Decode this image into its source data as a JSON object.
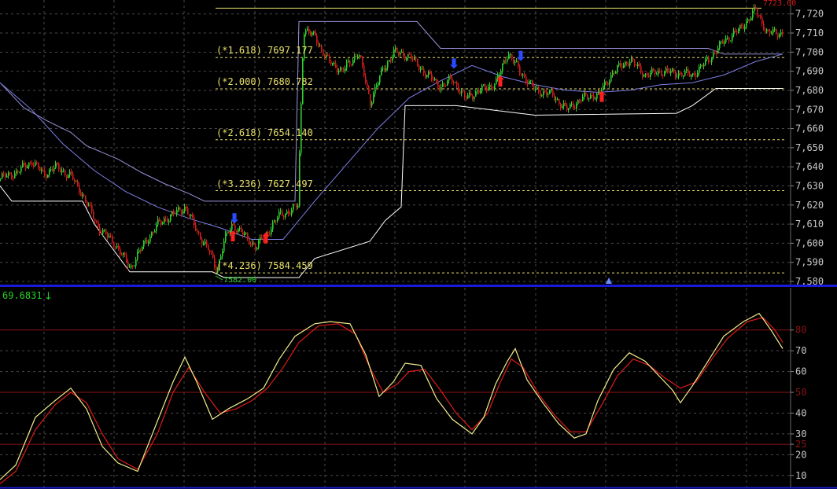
{
  "colors": {
    "background": "#000000",
    "grid": "#4a4a4a",
    "separator": "#1a1ad8",
    "candle_up": "#2fd02f",
    "candle_down": "#d01c1c",
    "fib": "#e8e06a",
    "envelope": "#ffffff",
    "channel": "#9a94d8",
    "moving_average": "#7e7ee6",
    "stoch_k": "#f2ee8c",
    "stoch_d": "#e01b1b",
    "level_line": "#8a1414",
    "signal_sell": "#2a4bff",
    "signal_buy": "#ff2020",
    "axis_text": "#c8c8c8",
    "indicator_value": "#24d024"
  },
  "price_panel": {
    "high_marker": "7723.00",
    "low_marker": "7582.00",
    "fib_levels": [
      {
        "label": "(*1.618) 7697.177",
        "value": 7697.177
      },
      {
        "label": "(*2.000) 7680.782",
        "value": 7680.782
      },
      {
        "label": "(*2.618) 7654.140",
        "value": 7654.14
      },
      {
        "label": "(*3.236) 7627.497",
        "value": 7627.497
      },
      {
        "label": "(*4.236) 7584.459",
        "value": 7584.459
      }
    ]
  },
  "indicator_panel": {
    "value": "69.6831",
    "arrow": "↓"
  },
  "chart_data": [
    {
      "type": "candlestick",
      "ylim": [
        7580,
        7724
      ],
      "y_ticks": [
        "7,580",
        "7,590",
        "7,600",
        "7,610",
        "7,620",
        "7,630",
        "7,640",
        "7,650",
        "7,660",
        "7,670",
        "7,680",
        "7,690",
        "7,700",
        "7,710",
        "7,720"
      ],
      "y_tick_values": [
        7580,
        7590,
        7600,
        7610,
        7620,
        7630,
        7640,
        7650,
        7660,
        7670,
        7680,
        7690,
        7700,
        7710,
        7720
      ],
      "close_path": [
        [
          0,
          7634
        ],
        [
          20,
          7637
        ],
        [
          40,
          7643
        ],
        [
          55,
          7636
        ],
        [
          70,
          7640
        ],
        [
          90,
          7635
        ],
        [
          105,
          7625
        ],
        [
          125,
          7608
        ],
        [
          145,
          7600
        ],
        [
          165,
          7587
        ],
        [
          180,
          7598
        ],
        [
          200,
          7610
        ],
        [
          215,
          7614
        ],
        [
          235,
          7619
        ],
        [
          250,
          7606
        ],
        [
          265,
          7596
        ],
        [
          275,
          7586
        ],
        [
          285,
          7602
        ],
        [
          295,
          7610
        ],
        [
          310,
          7604
        ],
        [
          325,
          7598
        ],
        [
          340,
          7606
        ],
        [
          355,
          7615
        ],
        [
          370,
          7617
        ],
        [
          378,
          7620
        ],
        [
          385,
          7712
        ],
        [
          400,
          7708
        ],
        [
          415,
          7696
        ],
        [
          435,
          7690
        ],
        [
          455,
          7700
        ],
        [
          470,
          7674
        ],
        [
          485,
          7690
        ],
        [
          500,
          7700
        ],
        [
          520,
          7698
        ],
        [
          540,
          7689
        ],
        [
          560,
          7682
        ],
        [
          575,
          7686
        ],
        [
          590,
          7676
        ],
        [
          610,
          7680
        ],
        [
          630,
          7684
        ],
        [
          645,
          7700
        ],
        [
          660,
          7690
        ],
        [
          680,
          7680
        ],
        [
          700,
          7678
        ],
        [
          720,
          7670
        ],
        [
          740,
          7676
        ],
        [
          760,
          7678
        ],
        [
          780,
          7690
        ],
        [
          800,
          7696
        ],
        [
          820,
          7688
        ],
        [
          840,
          7690
        ],
        [
          860,
          7689
        ],
        [
          880,
          7688
        ],
        [
          900,
          7696
        ],
        [
          920,
          7706
        ],
        [
          940,
          7712
        ],
        [
          960,
          7722
        ],
        [
          975,
          7710
        ],
        [
          995,
          7710
        ]
      ],
      "moving_average": [
        [
          0,
          7684
        ],
        [
          40,
          7670
        ],
        [
          80,
          7652
        ],
        [
          120,
          7638
        ],
        [
          160,
          7627
        ],
        [
          200,
          7619
        ],
        [
          240,
          7613
        ],
        [
          280,
          7608
        ],
        [
          320,
          7602
        ],
        [
          360,
          7602
        ],
        [
          400,
          7622
        ],
        [
          440,
          7641
        ],
        [
          480,
          7660
        ],
        [
          520,
          7676
        ],
        [
          560,
          7685
        ],
        [
          600,
          7693
        ],
        [
          640,
          7687
        ],
        [
          680,
          7683
        ],
        [
          720,
          7680
        ],
        [
          760,
          7679
        ],
        [
          800,
          7680
        ],
        [
          840,
          7683
        ],
        [
          880,
          7684
        ],
        [
          920,
          7688
        ],
        [
          960,
          7695
        ],
        [
          995,
          7699
        ]
      ],
      "channel_upper": [
        [
          0,
          7684
        ],
        [
          30,
          7671
        ],
        [
          60,
          7664
        ],
        [
          90,
          7658
        ],
        [
          110,
          7651
        ],
        [
          150,
          7644
        ],
        [
          180,
          7637
        ],
        [
          210,
          7631
        ],
        [
          240,
          7626
        ],
        [
          260,
          7622
        ],
        [
          375,
          7622
        ],
        [
          380,
          7716
        ],
        [
          530,
          7716
        ],
        [
          560,
          7702
        ],
        [
          900,
          7702
        ],
        [
          920,
          7699
        ],
        [
          995,
          7699
        ]
      ],
      "envelope_lower": [
        [
          0,
          7630
        ],
        [
          15,
          7622
        ],
        [
          105,
          7622
        ],
        [
          120,
          7610
        ],
        [
          165,
          7585
        ],
        [
          270,
          7585
        ],
        [
          285,
          7582
        ],
        [
          380,
          7582
        ],
        [
          400,
          7592
        ],
        [
          470,
          7601
        ],
        [
          490,
          7612
        ],
        [
          510,
          7619
        ],
        [
          515,
          7672
        ],
        [
          580,
          7672
        ],
        [
          680,
          7667
        ],
        [
          860,
          7668
        ],
        [
          880,
          7672
        ],
        [
          900,
          7678
        ],
        [
          910,
          7681
        ],
        [
          995,
          7681
        ]
      ],
      "signals": [
        {
          "kind": "sell",
          "x": 298,
          "price": 7612
        },
        {
          "kind": "buy",
          "x": 296,
          "price": 7603
        },
        {
          "kind": "buy",
          "x": 338,
          "price": 7602
        },
        {
          "kind": "sell",
          "x": 577,
          "price": 7693
        },
        {
          "kind": "buy",
          "x": 636,
          "price": 7684
        },
        {
          "kind": "sell",
          "x": 662,
          "price": 7697
        },
        {
          "kind": "buy",
          "x": 765,
          "price": 7676
        }
      ]
    },
    {
      "type": "line",
      "title": "",
      "ylim": [
        5,
        92
      ],
      "y_ticks": [
        "10",
        "20",
        "25",
        "30",
        "40",
        "50",
        "60",
        "70",
        "80"
      ],
      "y_tick_values": [
        10,
        20,
        25,
        30,
        40,
        50,
        60,
        70,
        80
      ],
      "reference_levels": [
        25,
        50,
        80
      ],
      "series": [
        {
          "key": "k",
          "values": [
            [
              0,
              8
            ],
            [
              20,
              15
            ],
            [
              45,
              38
            ],
            [
              70,
              46
            ],
            [
              90,
              52
            ],
            [
              110,
              42
            ],
            [
              130,
              24
            ],
            [
              150,
              16
            ],
            [
              175,
              12
            ],
            [
              200,
              36
            ],
            [
              220,
              55
            ],
            [
              235,
              67
            ],
            [
              250,
              55
            ],
            [
              270,
              37
            ],
            [
              290,
              42
            ],
            [
              315,
              47
            ],
            [
              335,
              52
            ],
            [
              355,
              66
            ],
            [
              375,
              77
            ],
            [
              400,
              83
            ],
            [
              420,
              84
            ],
            [
              445,
              83
            ],
            [
              465,
              68
            ],
            [
              482,
              48
            ],
            [
              500,
              55
            ],
            [
              515,
              64
            ],
            [
              535,
              63
            ],
            [
              555,
              47
            ],
            [
              575,
              37
            ],
            [
              600,
              30
            ],
            [
              615,
              38
            ],
            [
              630,
              54
            ],
            [
              645,
              65
            ],
            [
              655,
              71
            ],
            [
              670,
              56
            ],
            [
              690,
              45
            ],
            [
              710,
              35
            ],
            [
              730,
              28
            ],
            [
              745,
              30
            ],
            [
              760,
              46
            ],
            [
              780,
              61
            ],
            [
              800,
              69
            ],
            [
              820,
              65
            ],
            [
              840,
              57
            ],
            [
              855,
              51
            ],
            [
              865,
              45
            ],
            [
              880,
              53
            ],
            [
              900,
              65
            ],
            [
              920,
              77
            ],
            [
              945,
              84
            ],
            [
              965,
              88
            ],
            [
              980,
              80
            ],
            [
              995,
              71
            ]
          ]
        },
        {
          "key": "d",
          "values": [
            [
              0,
              6
            ],
            [
              20,
              12
            ],
            [
              45,
              32
            ],
            [
              70,
              44
            ],
            [
              90,
              50
            ],
            [
              110,
              45
            ],
            [
              130,
              30
            ],
            [
              150,
              18
            ],
            [
              175,
              13
            ],
            [
              200,
              30
            ],
            [
              220,
              50
            ],
            [
              240,
              62
            ],
            [
              260,
              50
            ],
            [
              280,
              40
            ],
            [
              300,
              42
            ],
            [
              320,
              46
            ],
            [
              340,
              52
            ],
            [
              360,
              62
            ],
            [
              380,
              74
            ],
            [
              405,
              82
            ],
            [
              430,
              83
            ],
            [
              452,
              78
            ],
            [
              470,
              62
            ],
            [
              487,
              50
            ],
            [
              505,
              54
            ],
            [
              520,
              60
            ],
            [
              540,
              61
            ],
            [
              560,
              51
            ],
            [
              580,
              40
            ],
            [
              600,
              32
            ],
            [
              620,
              40
            ],
            [
              635,
              54
            ],
            [
              650,
              66
            ],
            [
              665,
              62
            ],
            [
              685,
              49
            ],
            [
              705,
              39
            ],
            [
              725,
              31
            ],
            [
              745,
              31
            ],
            [
              765,
              44
            ],
            [
              785,
              58
            ],
            [
              805,
              66
            ],
            [
              825,
              63
            ],
            [
              845,
              57
            ],
            [
              865,
              52
            ],
            [
              885,
              55
            ],
            [
              905,
              66
            ],
            [
              925,
              76
            ],
            [
              950,
              84
            ],
            [
              970,
              86
            ],
            [
              985,
              80
            ],
            [
              995,
              74
            ]
          ]
        }
      ]
    }
  ]
}
